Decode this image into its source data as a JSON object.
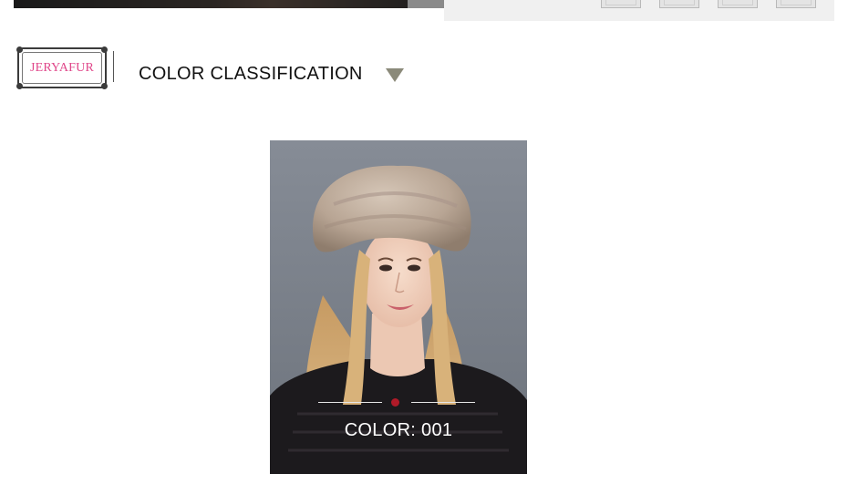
{
  "brand": {
    "logo_text": "JERYAFUR"
  },
  "section": {
    "title": "COLOR CLASSIFICATION",
    "indicator_icon": "triangle-down-icon"
  },
  "product": {
    "color_label": "COLOR: 001"
  },
  "colors": {
    "logo_pink": "#e0478a",
    "triangle": "#8b8a7a",
    "accent_dot": "#b01a28",
    "photo_bg": "#7f8690"
  }
}
